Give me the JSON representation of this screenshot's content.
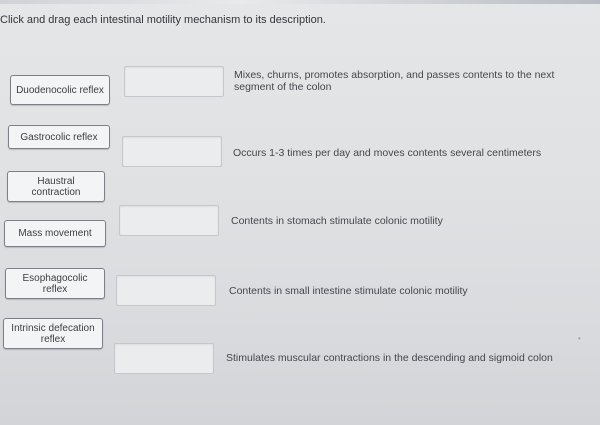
{
  "instruction": "Click and drag each intestinal motility mechanism to its description.",
  "chips": [
    {
      "label": "Duodenocolic reflex"
    },
    {
      "label": "Gastrocolic reflex"
    },
    {
      "label": "Haustral contraction"
    },
    {
      "label": "Mass movement"
    },
    {
      "label": "Esophagocolic reflex"
    },
    {
      "label": "Intrinsic defecation reflex"
    }
  ],
  "targets": [
    {
      "description": "Mixes, churns, promotes absorption, and passes contents to the next segment of the colon"
    },
    {
      "description": "Occurs 1-3 times per day and moves contents several centimeters"
    },
    {
      "description": "Contents in stomach stimulate colonic motility"
    },
    {
      "description": "Contents in small intestine stimulate colonic motility"
    },
    {
      "description": "Stimulates muscular contractions in the descending and sigmoid colon"
    }
  ]
}
